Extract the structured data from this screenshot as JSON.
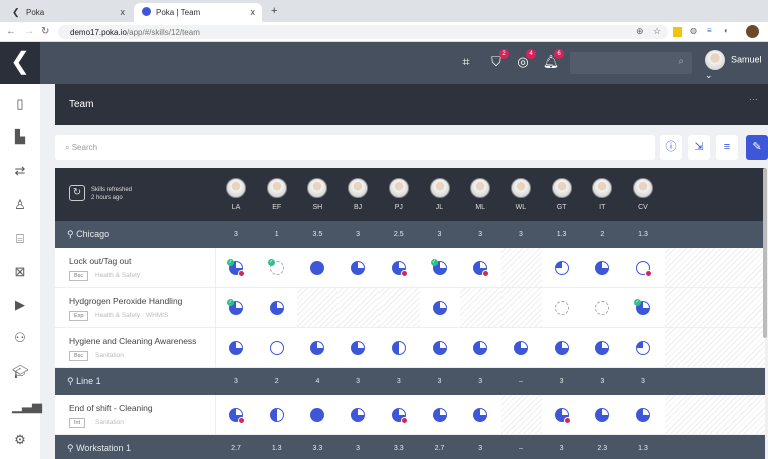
{
  "browser": {
    "tabs": [
      {
        "label": "Poka"
      },
      {
        "label": "Poka | Team"
      }
    ],
    "url_host": "demo17.poka.io",
    "url_path": "/app/#/skills/12/team",
    "close": "x",
    "new_tab": "+"
  },
  "topbar": {
    "badges": {
      "shield": "2",
      "compass": "4",
      "bell": "6"
    },
    "user": "Samuel"
  },
  "page": {
    "title": "Team",
    "more": "···"
  },
  "search": {
    "placeholder": "Search"
  },
  "grid": {
    "refresh_line1": "Skills refreshed",
    "refresh_line2": "2 hours ago",
    "people": [
      "LA",
      "EF",
      "SH",
      "BJ",
      "PJ",
      "JL",
      "ML",
      "WL",
      "GT",
      "IT",
      "CV"
    ],
    "groups": [
      {
        "location": "Chicago",
        "scores": [
          "3",
          "1",
          "3.5",
          "3",
          "2.5",
          "3",
          "3",
          "3",
          "1.3",
          "2",
          "1.3"
        ],
        "skills": [
          {
            "title": "Lock out/Tag out",
            "tag": "Bsc",
            "category": "Health & Safety",
            "cells": [
              "q3:ck,cl",
              "dashed:ck",
              "full",
              "q3",
              "q3:cl",
              "q3:ck",
              "q3:cl",
              "none",
              "q1",
              "q3",
              "empty:cl"
            ]
          },
          {
            "title": "Hydgrogen Peroxide Handling",
            "tag": "Exp",
            "category": "Health & Safety · WHMIS",
            "cells": [
              "q3:ck",
              "q3",
              "none",
              "none",
              "none",
              "q3",
              "none",
              "none",
              "dashed",
              "dashed",
              "q3:ck"
            ]
          },
          {
            "title": "Hygiene and Cleaning Awareness",
            "tag": "Bsc",
            "category": "Sanitation",
            "cells": [
              "q3",
              "empty",
              "q3",
              "q3",
              "half",
              "q3",
              "q3",
              "q3",
              "q3",
              "q3",
              "q1"
            ]
          }
        ]
      },
      {
        "location": "Line 1",
        "scores": [
          "3",
          "2",
          "4",
          "3",
          "3",
          "3",
          "3",
          "–",
          "3",
          "3",
          "3"
        ],
        "skills": [
          {
            "title": "End of shift - Cleaning",
            "tag": "Int",
            "category": "Sanitation",
            "cells": [
              "q3:cl",
              "half",
              "full",
              "q3",
              "q3:cl",
              "q3",
              "q3",
              "none",
              "q3:cl",
              "q3",
              "q3"
            ]
          }
        ]
      },
      {
        "location": "Workstation 1",
        "scores": [
          "2.7",
          "1.3",
          "3.3",
          "3",
          "3.3",
          "2.7",
          "3",
          "–",
          "3",
          "2.3",
          "1.3"
        ],
        "skills": []
      }
    ]
  },
  "colors": {
    "accent": "#3d57d8",
    "check": "#2fbf8a",
    "alert": "#d6245a"
  }
}
